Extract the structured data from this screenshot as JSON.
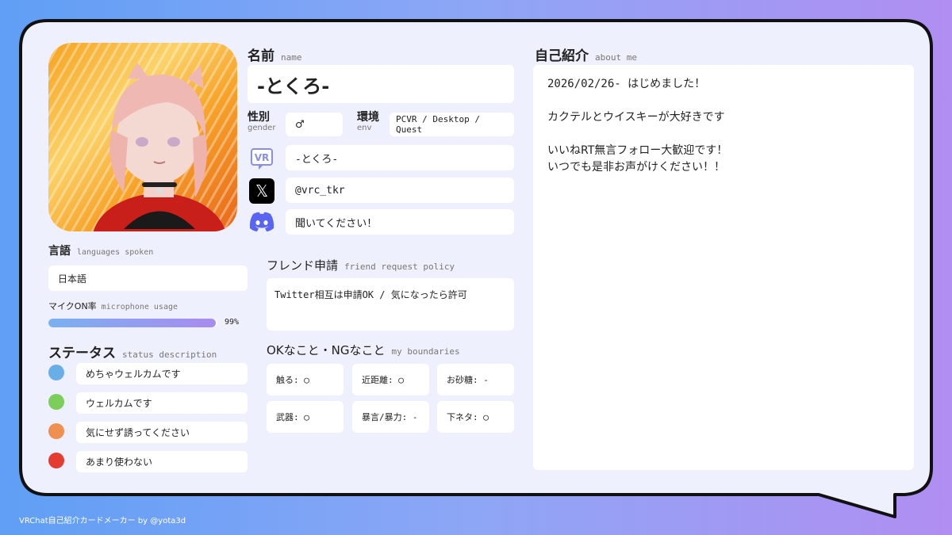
{
  "name": {
    "heading": "名前",
    "heading_en": "name",
    "value": "-とくろ-"
  },
  "gender": {
    "label": "性別",
    "label_en": "gender",
    "value": "♂"
  },
  "env": {
    "label": "環境",
    "label_en": "env",
    "value": "PCVR / Desktop / Quest"
  },
  "accounts": {
    "vrchat": {
      "icon": "vrchat-icon",
      "icon_text": "VR",
      "value": "-とくろ-"
    },
    "x": {
      "icon": "x-logo-icon",
      "icon_text": "𝕏",
      "value": "@vrc_tkr"
    },
    "discord": {
      "icon": "discord-icon",
      "value": "聞いてください！"
    }
  },
  "languages": {
    "heading": "言語",
    "heading_en": "languages spoken",
    "value": "日本語"
  },
  "mic": {
    "label": "マイクON率",
    "label_en": "microphone usage",
    "percent": 99,
    "percent_text": "99%"
  },
  "status": {
    "heading": "ステータス",
    "heading_en": "status description",
    "items": [
      {
        "color": "#6aaee8",
        "text": "めちゃウェルカムです"
      },
      {
        "color": "#7cce5a",
        "text": "ウェルカムです"
      },
      {
        "color": "#ef9050",
        "text": "気にせず誘ってください"
      },
      {
        "color": "#e43c30",
        "text": "あまり使わない"
      }
    ]
  },
  "friend": {
    "heading": "フレンド申請",
    "heading_en": "friend request policy",
    "value": "Twitter相互は申請OK / 気になったら許可"
  },
  "boundaries": {
    "heading": "OKなこと・NGなこと",
    "heading_en": "my boundaries",
    "items": [
      "触る: ◯",
      "近距離: ◯",
      "お砂糖: -",
      "武器: ◯",
      "暴言/暴力: -",
      "下ネタ: ◯"
    ]
  },
  "about": {
    "heading": "自己紹介",
    "heading_en": "about me",
    "lines": [
      "2026/02/26- はじめました！",
      "",
      "カクテルとウイスキーが大好きです",
      "",
      "いいねRT無言フォロー大歓迎です！",
      "いつでも是非お声がけください！！"
    ]
  },
  "footer": "VRChat自己紹介カードメーカー by @yota3d",
  "colors": {
    "card_bg": "#eef0fd",
    "outline": "#111111",
    "mic_bar_start": "#7ab0f2",
    "mic_bar_end": "#a98bf0"
  }
}
